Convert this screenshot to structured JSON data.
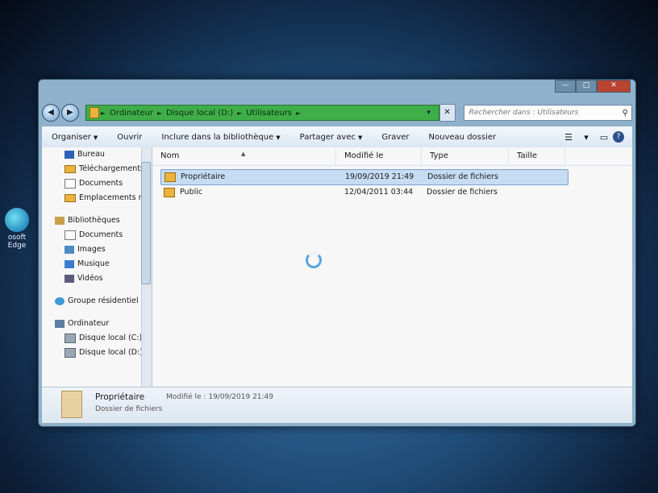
{
  "desktop": {
    "edge_label_line1": "osoft",
    "edge_label_line2": "Edge"
  },
  "window": {
    "caption": {
      "minimize": "—",
      "maximize": "□",
      "close": "✕"
    }
  },
  "nav": {
    "back": "◀",
    "forward": "▶",
    "breadcrumb": [
      "Ordinateur",
      "Disque local (D:)",
      "Utilisateurs"
    ],
    "search_placeholder": "Rechercher dans : Utilisateurs"
  },
  "toolbar": {
    "organize": "Organiser",
    "open": "Ouvrir",
    "include": "Inclure dans la bibliothèque",
    "share": "Partager avec",
    "burn": "Graver",
    "new_folder": "Nouveau dossier"
  },
  "sidebar": {
    "favorites": [
      {
        "label": "Bureau",
        "icon": "desktop-icon"
      },
      {
        "label": "Téléchargements",
        "icon": "downloads-icon"
      },
      {
        "label": "Documents",
        "icon": "documents-icon"
      },
      {
        "label": "Emplacements ré",
        "icon": "recent-places-icon"
      }
    ],
    "libraries_label": "Bibliothèques",
    "libraries": [
      {
        "label": "Documents"
      },
      {
        "label": "Images"
      },
      {
        "label": "Musique"
      },
      {
        "label": "Vidéos"
      }
    ],
    "homegroup": "Groupe résidentiel",
    "computer_label": "Ordinateur",
    "drives": [
      {
        "label": "Disque local (C:)"
      },
      {
        "label": "Disque local (D:)"
      }
    ]
  },
  "columns": {
    "name": "Nom",
    "modified": "Modifié le",
    "type": "Type",
    "size": "Taille"
  },
  "files": [
    {
      "name": "Propriétaire",
      "modified": "19/09/2019 21:49",
      "type": "Dossier de fichiers",
      "selected": true
    },
    {
      "name": "Public",
      "modified": "12/04/2011 03:44",
      "type": "Dossier de fichiers",
      "selected": false
    }
  ],
  "details": {
    "name": "Propriétaire",
    "modified": "Modifié le : 19/09/2019 21:49",
    "type": "Dossier de fichiers"
  }
}
